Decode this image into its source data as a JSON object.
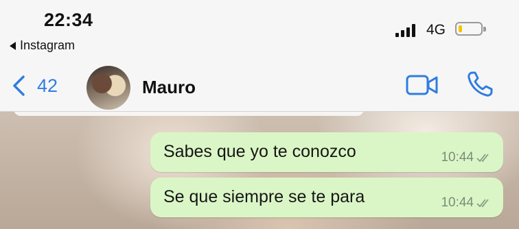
{
  "status_bar": {
    "time": "22:34",
    "back_app_label": "Instagram",
    "network": "4G",
    "signal_icon": "signal-bars-icon",
    "battery_icon": "battery-low-icon",
    "battery_color": "#f2c500"
  },
  "header": {
    "back_count": "42",
    "contact_name": "Mauro",
    "accent_color": "#2e7de0"
  },
  "messages": [
    {
      "text": "Sabes que yo te conozco",
      "time": "10:44",
      "status_icon": "double-check-icon"
    },
    {
      "text": "Se que siempre se te para",
      "time": "10:44",
      "status_icon": "double-check-icon"
    }
  ],
  "bubble_color": "#dbf6c6"
}
